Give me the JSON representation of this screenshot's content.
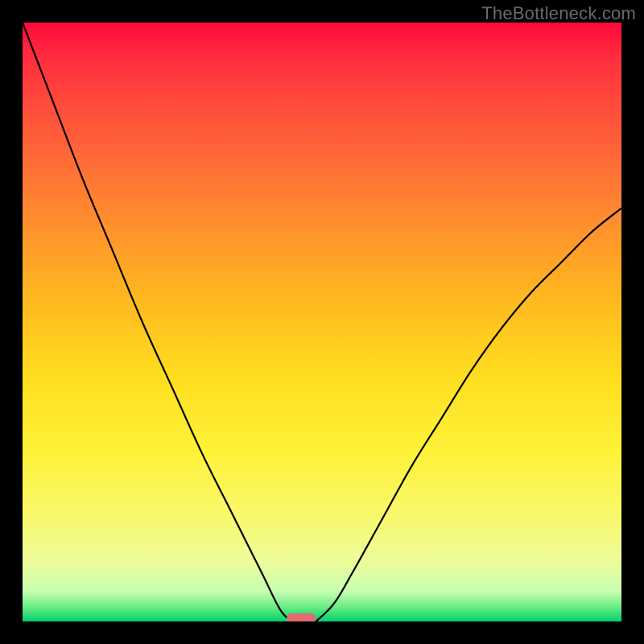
{
  "watermark": "TheBottleneck.com",
  "colors": {
    "frame": "#000000",
    "pill": "#e46a6f",
    "curve": "#000000"
  },
  "chart_data": {
    "type": "line",
    "title": "",
    "xlabel": "",
    "ylabel": "",
    "xlim": [
      0,
      1
    ],
    "ylim": [
      0,
      1
    ],
    "grid": false,
    "legend": false,
    "series": [
      {
        "name": "left-curve",
        "x": [
          0.0,
          0.05,
          0.1,
          0.15,
          0.2,
          0.25,
          0.3,
          0.35,
          0.4,
          0.43,
          0.45
        ],
        "y": [
          1.0,
          0.87,
          0.74,
          0.62,
          0.5,
          0.39,
          0.28,
          0.18,
          0.08,
          0.02,
          0.0
        ]
      },
      {
        "name": "right-curve",
        "x": [
          0.49,
          0.52,
          0.55,
          0.6,
          0.65,
          0.7,
          0.75,
          0.8,
          0.85,
          0.9,
          0.95,
          1.0
        ],
        "y": [
          0.0,
          0.03,
          0.08,
          0.17,
          0.26,
          0.34,
          0.42,
          0.49,
          0.55,
          0.6,
          0.65,
          0.69
        ]
      }
    ],
    "marker": {
      "name": "optimal-point",
      "x": 0.465,
      "y": 0.0
    }
  }
}
